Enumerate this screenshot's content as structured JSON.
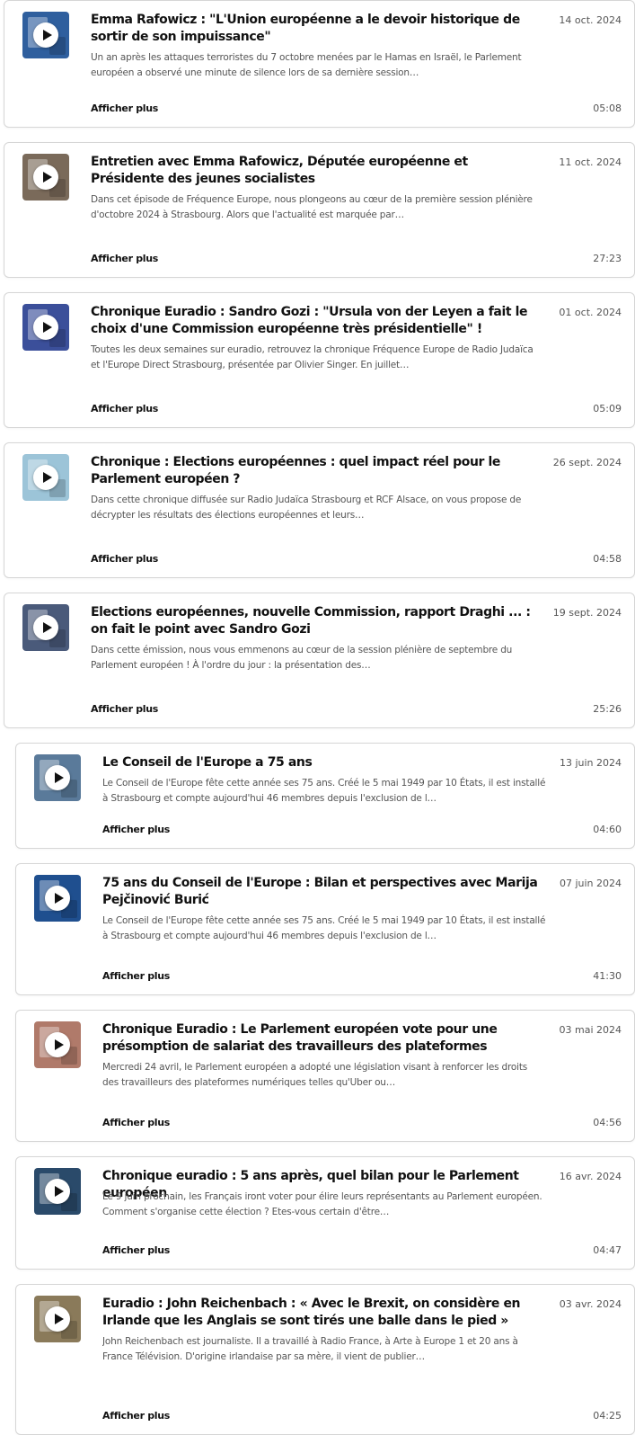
{
  "colors": {
    "card_border": "#d6d6d6",
    "title_text": "#111111",
    "meta_text": "#555555",
    "play_button": "#ffffff"
  },
  "episodes": [
    {
      "title": "Emma Rafowicz : \"L'Union européenne a le devoir historique de sortir de son impuissance\"",
      "description": "Un an après les attaques terroristes du 7 octobre menées par le Hamas en Israël, le Parlement européen a observé une minute de silence lors de sa dernière session…",
      "date": "14 oct. 2024",
      "duration": "05:08",
      "more_label": "Afficher plus",
      "thumb_icon": "play-icon",
      "thumb_color": "#2f5f9e"
    },
    {
      "title": "Entretien avec Emma Rafowicz, Députée européenne et Présidente des jeunes socialistes",
      "description": "Dans cet épisode de Fréquence Europe, nous plongeons au cœur de la première session plénière d'octobre 2024 à Strasbourg. Alors que l'actualité est marquée par…",
      "date": "11 oct. 2024",
      "duration": "27:23",
      "more_label": "Afficher plus",
      "thumb_icon": "play-icon",
      "thumb_color": "#7a6a5a"
    },
    {
      "title": "Chronique Euradio : Sandro Gozi : \"Ursula von der Leyen a fait le choix d'une Commission européenne très présidentielle\" !",
      "description": "Toutes les deux semaines sur euradio, retrouvez la chronique Fréquence Europe de Radio Judaïca et l'Europe Direct Strasbourg, présentée par Olivier Singer. En juillet…",
      "date": "01 oct. 2024",
      "duration": "05:09",
      "more_label": "Afficher plus",
      "thumb_icon": "play-icon",
      "thumb_color": "#3b4f9a"
    },
    {
      "title": "Chronique : Elections européennes : quel impact réel pour le Parlement européen ?",
      "description": "Dans cette chronique diffusée sur Radio Judaïca Strasbourg et RCF Alsace, on vous propose de décrypter les résultats des élections européennes et leurs…",
      "date": "26 sept. 2024",
      "duration": "04:58",
      "more_label": "Afficher plus",
      "thumb_icon": "play-icon",
      "thumb_color": "#9cc4d8"
    },
    {
      "title": "Elections européennes, nouvelle Commission, rapport Draghi ... : on fait le point avec Sandro Gozi",
      "description": "Dans cette émission, nous vous emmenons au cœur de la session plénière de septembre du Parlement européen ! À l'ordre du jour : la présentation des…",
      "date": "19 sept. 2024",
      "duration": "25:26",
      "more_label": "Afficher plus",
      "thumb_icon": "play-icon",
      "thumb_color": "#4a5a7a"
    },
    {
      "title": "Le Conseil de l'Europe a 75 ans",
      "description": "Le Conseil de l'Europe fête cette année ses 75 ans. Créé le 5 mai 1949 par 10 États, il est installé à Strasbourg et compte aujourd'hui 46 membres depuis l'exclusion de l…",
      "date": "13 juin 2024",
      "duration": "04:60",
      "more_label": "Afficher plus",
      "thumb_icon": "play-icon",
      "thumb_color": "#5a7a9a"
    },
    {
      "title": "75 ans du Conseil de l'Europe : Bilan et perspectives avec Marija Pejčinović Burić",
      "description": "Le Conseil de l'Europe fête cette année ses 75 ans. Créé le 5 mai 1949 par 10 États, il est installé à Strasbourg et compte aujourd'hui 46 membres depuis l'exclusion de l…",
      "date": "07 juin 2024",
      "duration": "41:30",
      "more_label": "Afficher plus",
      "thumb_icon": "play-icon",
      "thumb_color": "#1f4f8f"
    },
    {
      "title": "Chronique Euradio : Le Parlement européen vote pour une présomption de salariat des travailleurs des plateformes",
      "description": "Mercredi 24 avril, le Parlement européen a adopté une législation visant à renforcer les droits des travailleurs des plateformes numériques telles qu'Uber ou…",
      "date": "03 mai 2024",
      "duration": "04:56",
      "more_label": "Afficher plus",
      "thumb_icon": "play-icon",
      "thumb_color": "#b07a6a"
    },
    {
      "title": "Chronique euradio : 5 ans après, quel bilan pour le Parlement européen",
      "description": "Le 9 juin prochain, les Français iront voter pour élire leurs représentants au Parlement européen. Comment s'organise cette élection ? Etes-vous certain d'être…",
      "date": "16 avr. 2024",
      "duration": "04:47",
      "more_label": "Afficher plus",
      "thumb_icon": "play-icon",
      "thumb_color": "#2a4a6a"
    },
    {
      "title": "Euradio : John Reichenbach : « Avec le Brexit, on considère en Irlande que les Anglais se sont tirés une balle dans le pied »",
      "description": "John Reichenbach est journaliste. Il a travaillé à Radio France, à Arte à Europe 1 et 20 ans à France Télévision. D'origine irlandaise par sa mère, il vient de publier…",
      "date": "03 avr. 2024",
      "duration": "04:25",
      "more_label": "Afficher plus",
      "thumb_icon": "play-icon",
      "thumb_color": "#8a7a5a"
    }
  ]
}
